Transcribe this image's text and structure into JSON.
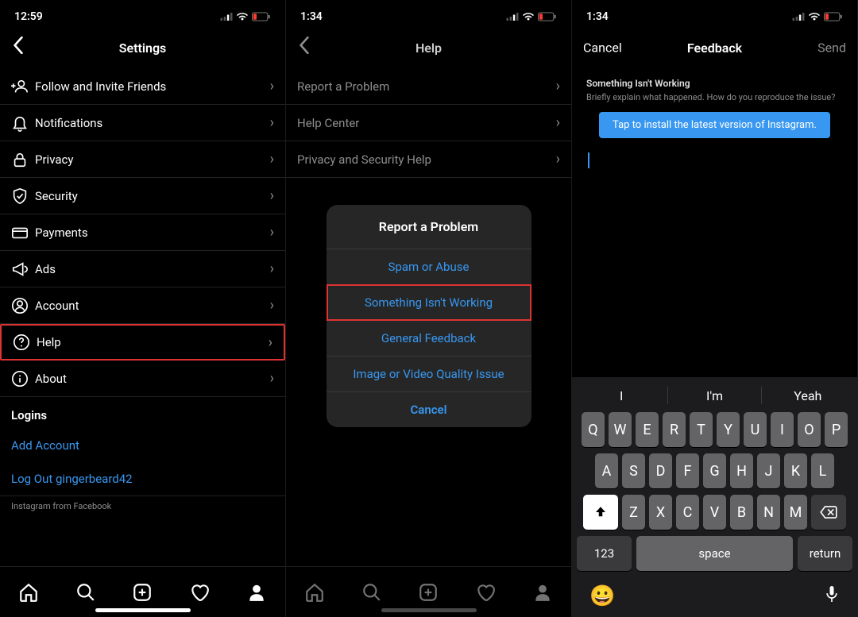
{
  "screen1": {
    "time": "12:59",
    "title": "Settings",
    "rows": [
      {
        "label": "Follow and Invite Friends"
      },
      {
        "label": "Notifications"
      },
      {
        "label": "Privacy"
      },
      {
        "label": "Security"
      },
      {
        "label": "Payments"
      },
      {
        "label": "Ads"
      },
      {
        "label": "Account"
      },
      {
        "label": "Help"
      },
      {
        "label": "About"
      }
    ],
    "logins_header": "Logins",
    "add_account": "Add Account",
    "logout": "Log Out gingerbeard42",
    "footer": "Instagram from Facebook"
  },
  "screen2": {
    "time": "1:34",
    "title": "Help",
    "rows": [
      {
        "label": "Report a Problem"
      },
      {
        "label": "Help Center"
      },
      {
        "label": "Privacy and Security Help"
      }
    ],
    "sheet_title": "Report a Problem",
    "sheet_items": [
      "Spam or Abuse",
      "Something Isn't Working",
      "General Feedback",
      "Image or Video Quality Issue"
    ],
    "sheet_cancel": "Cancel"
  },
  "screen3": {
    "time": "1:34",
    "title": "Feedback",
    "cancel": "Cancel",
    "send": "Send",
    "heading": "Something Isn't Working",
    "subtext": "Briefly explain what happened. How do you reproduce the issue?",
    "install": "Tap to install the latest version of Instagram.",
    "suggestions": [
      "I",
      "I'm",
      "Yeah"
    ],
    "keys_row1": [
      "Q",
      "W",
      "E",
      "R",
      "T",
      "Y",
      "U",
      "I",
      "O",
      "P"
    ],
    "keys_row2": [
      "A",
      "S",
      "D",
      "F",
      "G",
      "H",
      "J",
      "K",
      "L"
    ],
    "keys_row3": [
      "Z",
      "X",
      "C",
      "V",
      "B",
      "N",
      "M"
    ],
    "num_key": "123",
    "space_key": "space",
    "return_key": "return"
  }
}
